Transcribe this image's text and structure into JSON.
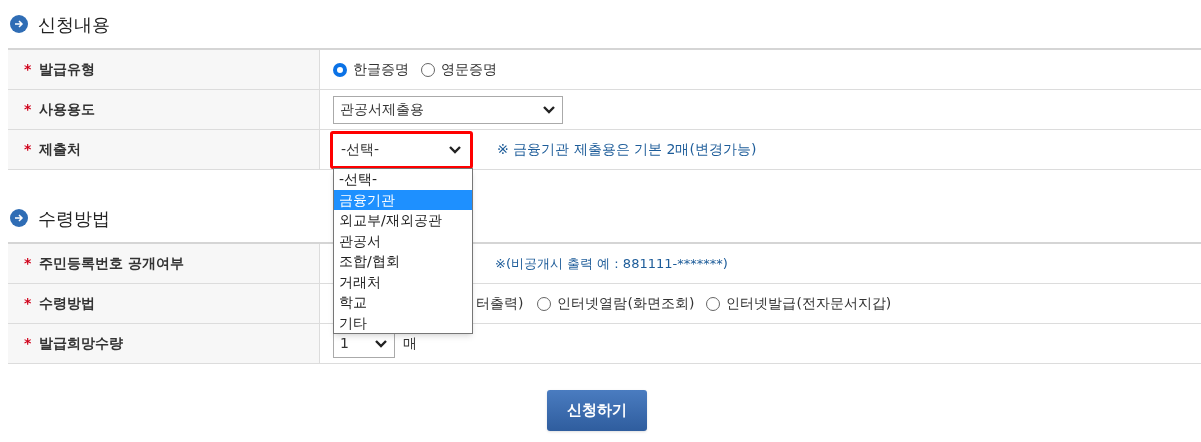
{
  "sections": [
    {
      "title": "신청내용",
      "rows": [
        {
          "label": "발급유형",
          "marker": "*",
          "kind": "radios",
          "options": [
            {
              "label": "한글증명",
              "selected": true
            },
            {
              "label": "영문증명",
              "selected": false
            }
          ]
        },
        {
          "label": "사용용도",
          "marker": "*",
          "kind": "select",
          "value": "관공서제출용"
        },
        {
          "label": "제출처",
          "marker": "*",
          "kind": "select",
          "value": "-선택-",
          "highlighted": true,
          "note": "※ 금융기관 제출용은 기본 2매(변경가능)"
        }
      ]
    },
    {
      "title": "수령방법",
      "rows": [
        {
          "label": "주민등록번호 공개여부",
          "marker": "*",
          "kind": "note",
          "note": "※(비공개시 출력 예 : 881111-*******)"
        },
        {
          "label": "수령방법",
          "marker": "*",
          "kind": "radios",
          "leading_text": "터출력)",
          "options": [
            {
              "label": "인터넷열람(화면조회)",
              "selected": false
            },
            {
              "label": "인터넷발급(전자문서지갑)",
              "selected": false
            }
          ]
        },
        {
          "label": "발급희망수량",
          "marker": "*",
          "kind": "small_select",
          "value": "1",
          "unit": "매"
        }
      ]
    }
  ],
  "dropdown": {
    "options": [
      {
        "label": "-선택-",
        "selected": false
      },
      {
        "label": "금융기관",
        "selected": true
      },
      {
        "label": "외교부/재외공관",
        "selected": false
      },
      {
        "label": "관공서",
        "selected": false
      },
      {
        "label": "조합/협회",
        "selected": false
      },
      {
        "label": "거래처",
        "selected": false
      },
      {
        "label": "학교",
        "selected": false
      },
      {
        "label": "기타",
        "selected": false
      }
    ]
  },
  "submit_button": "신청하기"
}
